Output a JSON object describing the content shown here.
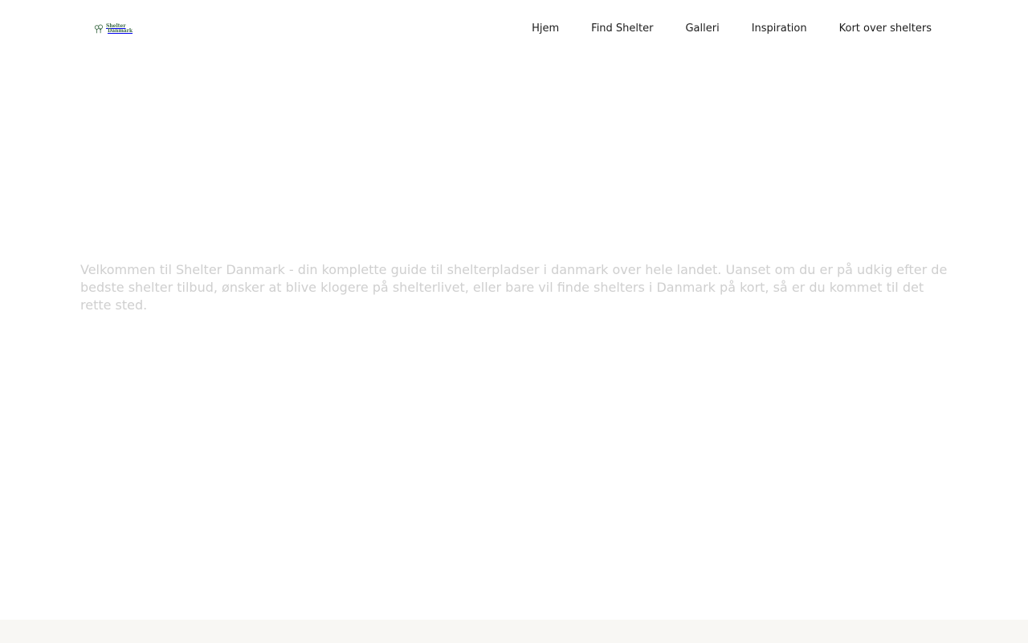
{
  "header": {
    "logo": {
      "line1": "Shelter",
      "line2": "Danmark",
      "icon": "trees-icon",
      "color": "#3c6a45"
    },
    "nav": [
      {
        "label": "Hjem"
      },
      {
        "label": "Find Shelter"
      },
      {
        "label": "Galleri"
      },
      {
        "label": "Inspiration"
      },
      {
        "label": "Kort over shelters"
      }
    ]
  },
  "hero": {
    "intro": "Velkommen til Shelter Danmark - din komplette guide til shelterpladser i danmark over hele landet. Uanset om du er på udkig efter de bedste shelter tilbud, ønsker at blive klogere på shelterlivet, eller bare vil finde shelters i Danmark på kort, så er du kommet til det rette sted.",
    "text_color": "#cfcfcf"
  },
  "footer": {
    "background": "#f8f7f4"
  }
}
